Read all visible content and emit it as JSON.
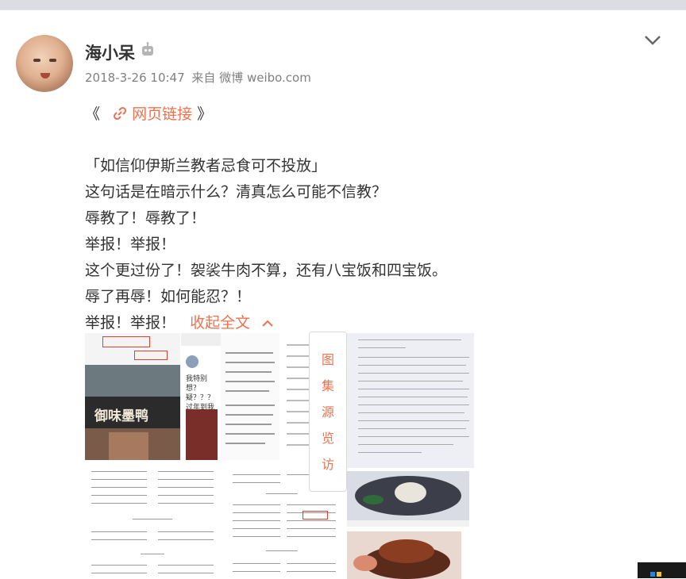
{
  "post": {
    "username": "海小呆",
    "timestamp": "2018-3-26 10:47",
    "source": "来自 微博 weibo.com",
    "link_prefix": "《",
    "link_label": "网页链接",
    "link_suffix": "》",
    "lines": [
      "「如信仰伊斯兰教者忌食可不投放」",
      "这句话是在暗示什么？清真怎么可能不信教？",
      "辱教了！辱教了！",
      "举报！举报！",
      "这个更过份了！袈裟牛肉不算，还有八宝饭和四宝饭。",
      "辱了再辱！如何能忍？！",
      "举报！举报！"
    ],
    "collapse_label": "收起全文"
  },
  "images": {
    "shop_sign": "御味墨鸭",
    "reply_snippet": "我特别想？ 疑？？？ 过年到我们",
    "source_panel": [
      "图",
      "集",
      "源",
      "览",
      "访"
    ]
  },
  "colors": {
    "accent": "#eb7350",
    "text": "#333333",
    "meta": "#808080"
  },
  "icons": [
    "link-icon",
    "robot-badge-icon",
    "chevron-down-icon",
    "chevron-up-icon"
  ]
}
